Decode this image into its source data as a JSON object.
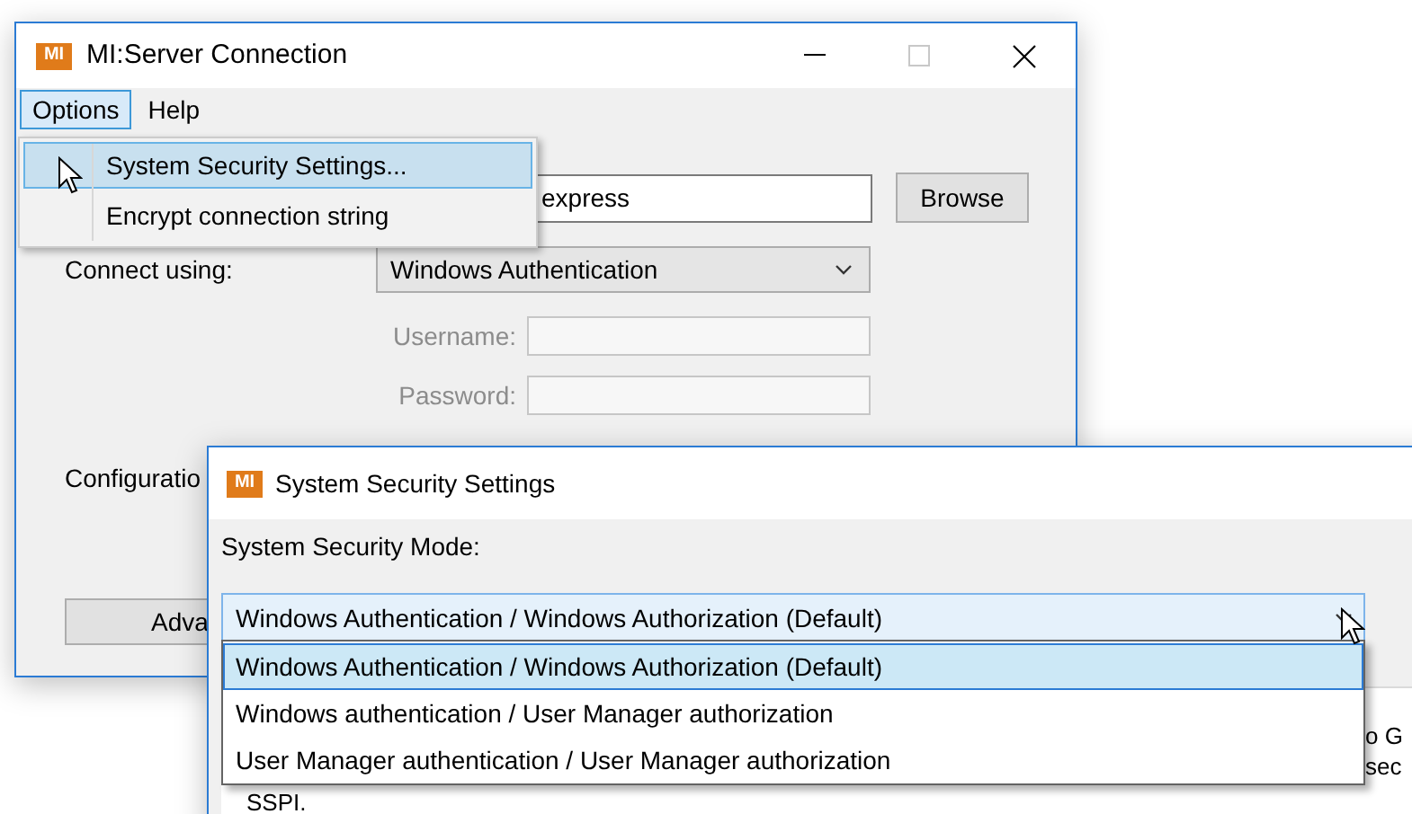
{
  "main_window": {
    "icon_label": "MI",
    "title": "MI:Server Connection",
    "menu": [
      {
        "label": "Options",
        "selected": true
      },
      {
        "label": "Help",
        "selected": false
      }
    ],
    "server_field": {
      "value": "express"
    },
    "browse_button": "Browse",
    "connect_label": "Connect using:",
    "connect_combo": {
      "value": "Windows Authentication"
    },
    "credentials": [
      {
        "label": "Username:",
        "disabled": true
      },
      {
        "label": "Password:",
        "disabled": true
      }
    ],
    "config_label": "Configuratio",
    "advanced_button": "Adva"
  },
  "options_menu": {
    "items": [
      {
        "label": "System Security Settings...",
        "selected": true
      },
      {
        "label": "Encrypt connection string",
        "selected": false
      }
    ]
  },
  "dialog": {
    "icon_label": "MI",
    "title": "System Security Settings",
    "mode_label": "System Security Mode:",
    "mode_combo": {
      "value": "Windows Authentication / Windows Authorization (Default)",
      "expanded": true
    },
    "options": [
      {
        "label": "Windows Authentication / Windows Authorization (Default)",
        "selected": true
      },
      {
        "label": "Windows authentication / User Manager authorization",
        "selected": false
      },
      {
        "label": "User Manager authentication / User Manager authorization",
        "selected": false
      }
    ],
    "description_fragments": [
      {
        "text": "o G",
        "kind": "tail"
      },
      {
        "text": "sec",
        "kind": "tail"
      },
      {
        "text": "SSPI.",
        "kind": "line"
      }
    ]
  }
}
